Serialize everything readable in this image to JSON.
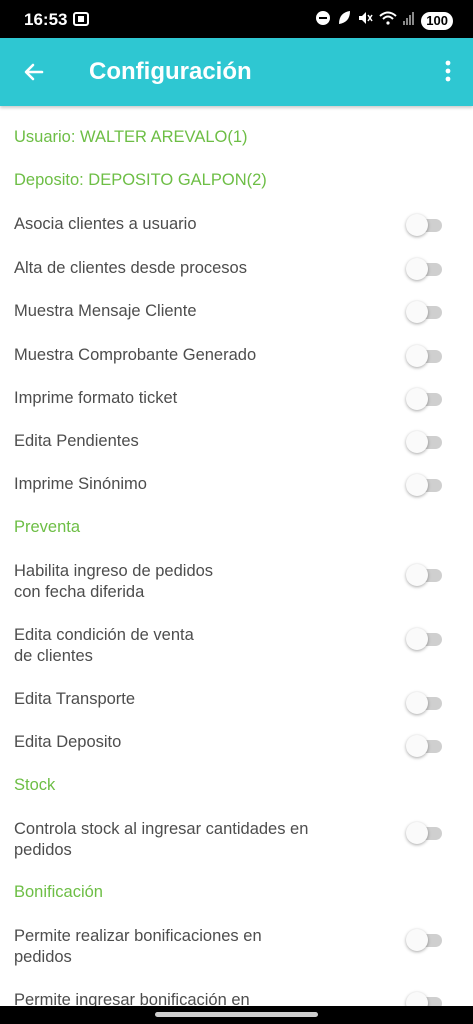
{
  "status": {
    "time": "16:53",
    "battery": "100"
  },
  "appbar": {
    "title": "Configuración"
  },
  "items": [
    {
      "type": "header",
      "label": "Usuario: WALTER AREVALO(1)"
    },
    {
      "type": "header",
      "label": "Deposito: DEPOSITO GALPON(2)"
    },
    {
      "type": "toggle",
      "label": "Asocia clientes a usuario",
      "on": false
    },
    {
      "type": "toggle",
      "label": "Alta de clientes desde procesos",
      "on": false
    },
    {
      "type": "toggle",
      "label": "Muestra Mensaje Cliente",
      "on": false
    },
    {
      "type": "toggle",
      "label": "Muestra Comprobante Generado",
      "on": false
    },
    {
      "type": "toggle",
      "label": "Imprime formato ticket",
      "on": false
    },
    {
      "type": "toggle",
      "label": "Edita Pendientes",
      "on": false
    },
    {
      "type": "toggle",
      "label": "Imprime Sinónimo",
      "on": false
    },
    {
      "type": "header",
      "label": "Preventa"
    },
    {
      "type": "toggle",
      "label": "Habilita ingreso de pedidos con fecha diferida",
      "on": false
    },
    {
      "type": "toggle",
      "label": "Edita condición de venta de clientes",
      "on": false
    },
    {
      "type": "toggle",
      "label": "Edita Transporte",
      "on": false
    },
    {
      "type": "toggle",
      "label": "Edita Deposito",
      "on": false
    },
    {
      "type": "header",
      "label": "Stock"
    },
    {
      "type": "toggle",
      "label": "Controla stock al ingresar cantidades en pedidos",
      "on": false
    },
    {
      "type": "header",
      "label": "Bonificación"
    },
    {
      "type": "toggle",
      "label": "Permite realizar bonificaciones en pedidos",
      "on": false
    },
    {
      "type": "toggle",
      "label": "Permite ingresar bonificación en",
      "on": false
    }
  ]
}
